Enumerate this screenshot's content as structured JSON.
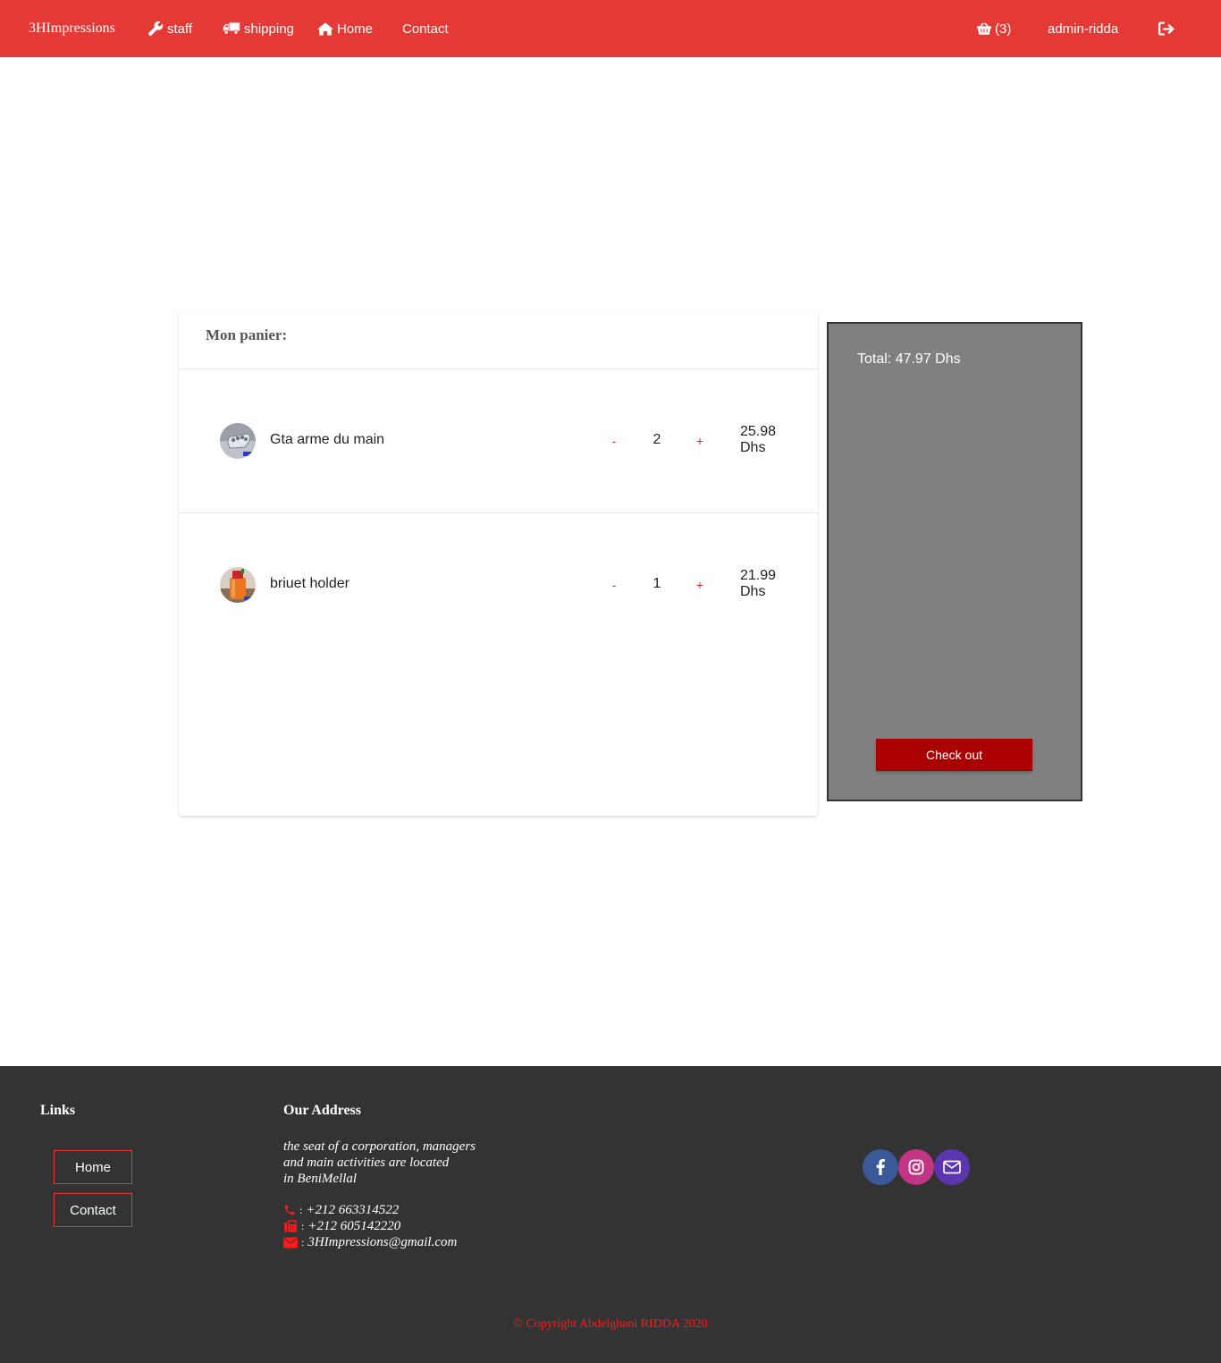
{
  "navbar": {
    "brand": "3HImpressions",
    "staff": "staff",
    "shipping": "shipping",
    "home": "Home",
    "contact": "Contact",
    "cart_count": "(3)",
    "user": "admin-ridda",
    "icons": {
      "staff": "wrench-icon",
      "shipping": "truck-icon",
      "home": "home-icon",
      "cart": "basket-icon",
      "logout": "sign-out-icon"
    },
    "color": "#e53935"
  },
  "cart": {
    "title": "Mon panier:",
    "items": [
      {
        "name": "Gta arme du main",
        "minus": "-",
        "qty": "2",
        "plus": "+",
        "price_line1": "25.98",
        "price_line2": "Dhs"
      },
      {
        "name": "briuet holder",
        "minus": "-",
        "qty": "1",
        "plus": "+",
        "price_line1": "21.99",
        "price_line2": "Dhs"
      }
    ]
  },
  "summary": {
    "total": "Total: 47.97 Dhs",
    "checkout_label": "Check out",
    "panel_color": "#808080",
    "button_color": "#aa0000"
  },
  "footer": {
    "links_heading": "Links",
    "links": [
      "Home",
      "Contact"
    ],
    "address_heading": "Our Address",
    "address_lines": [
      "the seat of a corporation, managers",
      "and main activities are located",
      "in BeniMellal"
    ],
    "separator": ":",
    "phone": "+212 663314522",
    "fax": "+212 605142220",
    "email": "3HImpressions@gmail.com",
    "social": [
      "facebook-icon",
      "instagram-icon",
      "envelope-icon"
    ],
    "copyright": "© Copyright Abdelghani RIDDA 2020",
    "background": "#333333"
  }
}
